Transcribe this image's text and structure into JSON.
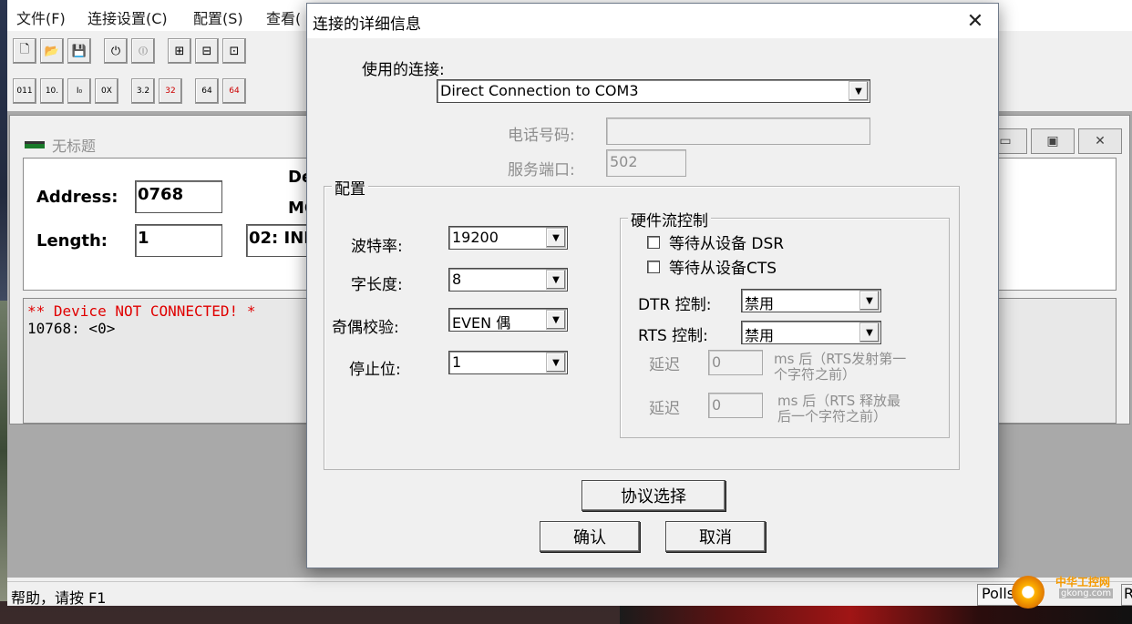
{
  "menu": {
    "file": "文件(F)",
    "connection_settings": "连接设置(C)",
    "config": "配置(S)",
    "view": "查看("
  },
  "toolbar1": {
    "new_icon": "new-file-icon",
    "open_icon": "open-folder-icon",
    "save_icon": "save-icon",
    "connect_icon": "connect-icon",
    "disconnect_icon": "disconnect-icon"
  },
  "toolbar2": {
    "labels": [
      "011",
      "10.",
      "I₀",
      "0X",
      "3.2",
      "32",
      "64",
      "64"
    ]
  },
  "child_window": {
    "title": "无标题",
    "address_label": "Address:",
    "address_value": "0768",
    "length_label": "Length:",
    "length_value": "1",
    "type_value": "02: INP",
    "device_label_partial": "De",
    "modbus_label_partial": "MO",
    "log_line1": "** Device NOT CONNECTED! *",
    "log_line2": "10768: <0>"
  },
  "statusbar": {
    "help": "帮助，请按 F1",
    "polls": "Polls: 0",
    "r": "R"
  },
  "watermark": {
    "cn": "中华工控网",
    "url": "gkong.com"
  },
  "dialog": {
    "title": "连接的详细信息",
    "connection_label": "使用的连接:",
    "connection_value": "Direct Connection to COM3",
    "phone_label": "电话号码:",
    "phone_value": "",
    "port_label": "服务端口:",
    "port_value": "502",
    "config_group": "配置",
    "baud_label": "波特率:",
    "baud_value": "19200",
    "word_length_label": "字长度:",
    "word_length_value": "8",
    "parity_label": "奇偶校验:",
    "parity_value": "EVEN 偶",
    "stop_bits_label": "停止位:",
    "stop_bits_value": "1",
    "hw_flow_group": "硬件流控制",
    "wait_dsr": "等待从设备 DSR",
    "wait_cts": "等待从设备CTS",
    "dtr_label": "DTR 控制:",
    "dtr_value": "禁用",
    "rts_label": "RTS 控制:",
    "rts_value": "禁用",
    "delay1_label": "延迟",
    "delay1_value": "0",
    "delay1_desc_line1": "ms 后（RTS发射第一",
    "delay1_desc_line2": "个字符之前）",
    "delay2_label": "延迟",
    "delay2_value": "0",
    "delay2_desc_line1": "ms 后（RTS 释放最",
    "delay2_desc_line2": "后一个字符之前）",
    "protocol_button": "协议选择",
    "ok_button": "确认",
    "cancel_button": "取消",
    "close_icon": "close-icon"
  }
}
